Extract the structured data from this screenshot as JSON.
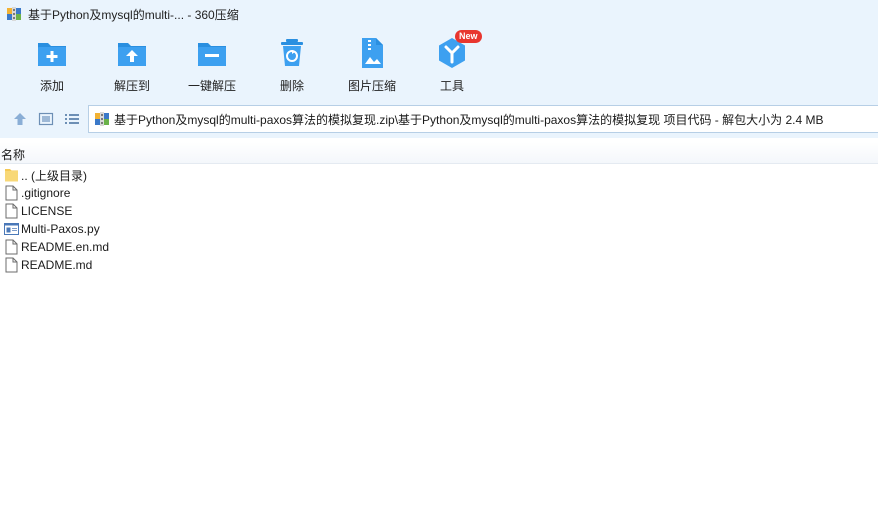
{
  "window": {
    "title": "基于Python及mysql的multi-... - 360压缩"
  },
  "toolbar": {
    "buttons": [
      {
        "label": "添加",
        "icon": "add-icon"
      },
      {
        "label": "解压到",
        "icon": "extract-to-icon"
      },
      {
        "label": "一键解压",
        "icon": "one-click-extract-icon"
      },
      {
        "label": "删除",
        "icon": "delete-icon"
      },
      {
        "label": "图片压缩",
        "icon": "image-compress-icon"
      },
      {
        "label": "工具",
        "icon": "tools-icon",
        "badge": "New"
      }
    ],
    "accent_color": "#2a8fe0",
    "badge_color": "#e8362f"
  },
  "address": {
    "path": "基于Python及mysql的multi-paxos算法的模拟复现.zip\\基于Python及mysql的multi-paxos算法的模拟复现 项目代码 - 解包大小为 2.4 MB"
  },
  "list": {
    "header_name": "名称",
    "items": [
      {
        "name": ".. (上级目录)",
        "icon": "folder-up-icon"
      },
      {
        "name": ".gitignore",
        "icon": "file-icon"
      },
      {
        "name": "LICENSE",
        "icon": "file-icon"
      },
      {
        "name": "Multi-Paxos.py",
        "icon": "python-file-icon"
      },
      {
        "name": "README.en.md",
        "icon": "file-icon"
      },
      {
        "name": "README.md",
        "icon": "file-icon"
      }
    ]
  }
}
